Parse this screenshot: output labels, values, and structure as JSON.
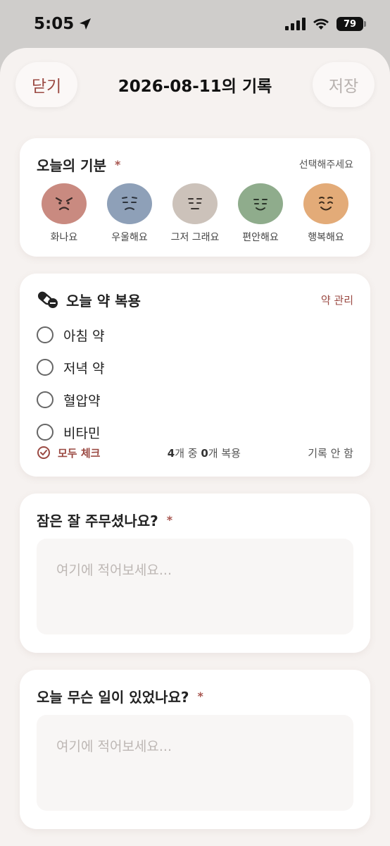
{
  "status": {
    "time": "5:05",
    "battery": "79"
  },
  "nav": {
    "close_label": "닫기",
    "title": "2026-08-11의 기록",
    "save_label": "저장"
  },
  "mood": {
    "title": "오늘의 기분",
    "required_mark": "*",
    "hint": "선택해주세요",
    "options": [
      {
        "label": "화나요",
        "color": "#c98a80"
      },
      {
        "label": "우울해요",
        "color": "#8ea0b8"
      },
      {
        "label": "그저 그래요",
        "color": "#ccc2ba"
      },
      {
        "label": "편안해요",
        "color": "#8fac8c"
      },
      {
        "label": "행복해요",
        "color": "#e3ab78"
      }
    ]
  },
  "meds": {
    "title": "오늘 약 복용",
    "manage_label": "약 관리",
    "items": [
      {
        "name": "아침 약"
      },
      {
        "name": "저녁 약"
      },
      {
        "name": "혈압약"
      },
      {
        "name": "비타민"
      }
    ],
    "check_all_label": "모두 체크",
    "count_total": "4",
    "count_mid": "개 중 ",
    "count_done": "0",
    "count_suffix": "개 복용",
    "no_record_label": "기록 안 함"
  },
  "sleep": {
    "question": "잠은 잘 주무셨나요?",
    "required_mark": "*",
    "placeholder": "여기에 적어보세요..."
  },
  "events": {
    "question": "오늘 무슨 일이 있었나요?",
    "required_mark": "*",
    "placeholder": "여기에 적어보세요..."
  },
  "colors": {
    "accent": "#9b4a43",
    "background": "#f6f2f0",
    "card": "#ffffff"
  }
}
